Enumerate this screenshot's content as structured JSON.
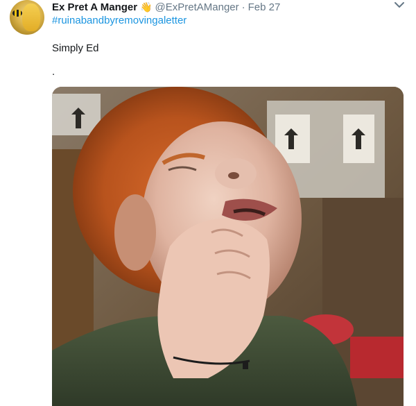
{
  "tweet": {
    "author_name": "Ex Pret A Manger",
    "badge_emoji": "👋",
    "handle": "@ExPretAManger",
    "separator": "·",
    "date": "Feb 27",
    "hashtag": "#ruinabandbyremovingaletter",
    "text_line_1": "Simply Ed",
    "text_line_2": ".",
    "icons": {
      "avatar": "avatar-bee-mannequin",
      "menu": "chevron-down-icon"
    },
    "media": {
      "kind": "video-still",
      "description_icon": "photo-icon"
    }
  },
  "colors": {
    "link": "#1b95e0",
    "secondary_text": "#657786",
    "primary_text": "#14171a"
  }
}
